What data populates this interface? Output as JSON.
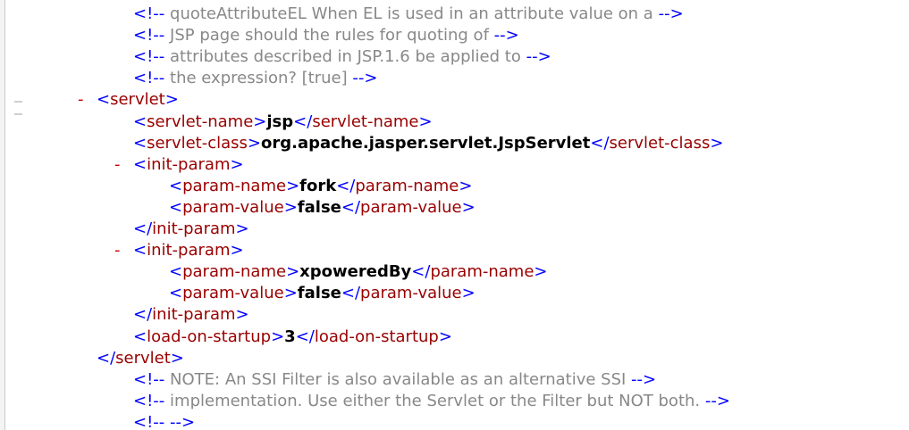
{
  "lines": [
    {
      "kind": "comment",
      "indent": 2,
      "text": "quoteAttributeEL When EL is used in an attribute value on a"
    },
    {
      "kind": "comment",
      "indent": 2,
      "text": "JSP page should the rules for quoting of"
    },
    {
      "kind": "comment",
      "indent": 2,
      "text": "attributes described in JSP.1.6 be applied to"
    },
    {
      "kind": "comment",
      "indent": 2,
      "text": "the expression? [true]"
    },
    {
      "kind": "open",
      "indent": 1,
      "tag": "servlet",
      "collapsible": true
    },
    {
      "kind": "element",
      "indent": 2,
      "tag": "servlet-name",
      "value": "jsp"
    },
    {
      "kind": "element",
      "indent": 2,
      "tag": "servlet-class",
      "value": "org.apache.jasper.servlet.JspServlet"
    },
    {
      "kind": "open",
      "indent": 2,
      "tag": "init-param",
      "collapsible": true
    },
    {
      "kind": "element",
      "indent": 3,
      "tag": "param-name",
      "value": "fork"
    },
    {
      "kind": "element",
      "indent": 3,
      "tag": "param-value",
      "value": "false"
    },
    {
      "kind": "close",
      "indent": 2,
      "tag": "init-param"
    },
    {
      "kind": "open",
      "indent": 2,
      "tag": "init-param",
      "collapsible": true
    },
    {
      "kind": "element",
      "indent": 3,
      "tag": "param-name",
      "value": "xpoweredBy"
    },
    {
      "kind": "element",
      "indent": 3,
      "tag": "param-value",
      "value": "false"
    },
    {
      "kind": "close",
      "indent": 2,
      "tag": "init-param"
    },
    {
      "kind": "element",
      "indent": 2,
      "tag": "load-on-startup",
      "value": "3"
    },
    {
      "kind": "close",
      "indent": 1,
      "tag": "servlet"
    },
    {
      "kind": "comment",
      "indent": 2,
      "text": "NOTE: An SSI Filter is also available as an alternative SSI"
    },
    {
      "kind": "comment",
      "indent": 2,
      "text": "implementation. Use either the Servlet or the Filter but NOT both."
    },
    {
      "kind": "comment",
      "indent": 2,
      "text": ""
    }
  ],
  "toggle_symbol": "-",
  "colors": {
    "bracket": "#0000ff",
    "tag": "#990000",
    "text": "#000000",
    "comment": "#888888",
    "toggle": "#d00000"
  }
}
